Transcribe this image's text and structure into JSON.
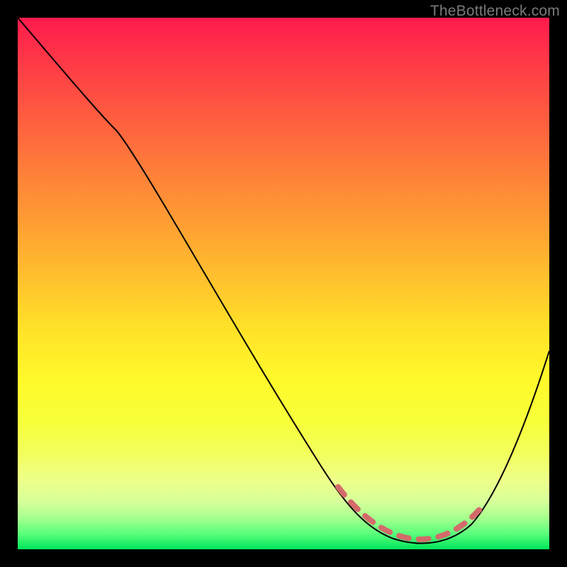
{
  "watermark": "TheBottleneck.com",
  "chart_data": {
    "type": "line",
    "title": "",
    "xlabel": "",
    "ylabel": "",
    "xlim": [
      0,
      100
    ],
    "ylim": [
      0,
      100
    ],
    "series": [
      {
        "name": "curve",
        "x": [
          0,
          10,
          18,
          30,
          45,
          58,
          64,
          70,
          76,
          82,
          88,
          94,
          100
        ],
        "values": [
          100,
          90,
          82,
          64,
          42,
          22,
          10,
          3,
          1,
          2,
          8,
          22,
          40
        ]
      }
    ],
    "valley_band": {
      "note": "highlighted low-bottleneck region",
      "x": [
        60,
        66,
        72,
        78,
        84,
        88
      ],
      "values": [
        11,
        5,
        2,
        1,
        4,
        10
      ]
    }
  }
}
